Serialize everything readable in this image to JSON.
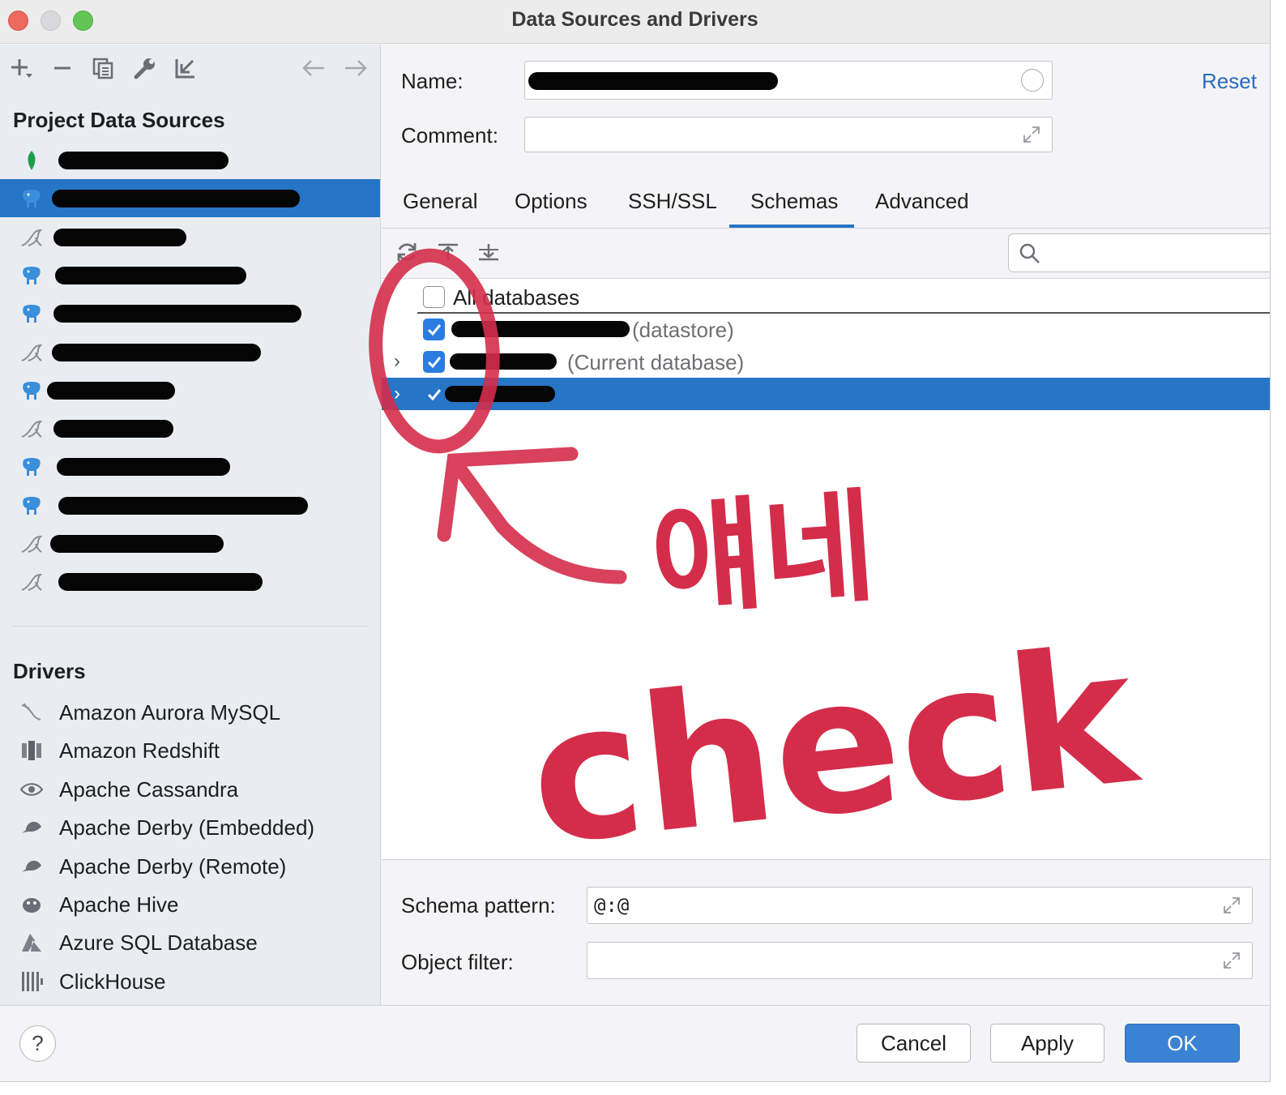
{
  "window": {
    "title": "Data Sources and Drivers"
  },
  "left": {
    "project_title": "Project Data Sources",
    "drivers_title": "Drivers",
    "datasources": [
      {
        "icon": "mongodb-leaf-icon"
      },
      {
        "icon": "postgresql-elephant-icon",
        "selected": true
      },
      {
        "icon": "mysql-dolphin-icon"
      },
      {
        "icon": "postgresql-elephant-icon"
      },
      {
        "icon": "postgresql-elephant-icon"
      },
      {
        "icon": "mysql-dolphin-icon"
      },
      {
        "icon": "postgresql-elephant-icon"
      },
      {
        "icon": "mysql-dolphin-icon"
      },
      {
        "icon": "postgresql-elephant-icon"
      },
      {
        "icon": "postgresql-elephant-icon"
      },
      {
        "icon": "mysql-dolphin-icon"
      },
      {
        "icon": "mysql-dolphin-icon"
      }
    ],
    "drivers": [
      {
        "label": "Amazon Aurora MySQL",
        "icon": "dolphin-icon"
      },
      {
        "label": "Amazon Redshift",
        "icon": "redshift-icon"
      },
      {
        "label": "Apache Cassandra",
        "icon": "eye-icon"
      },
      {
        "label": "Apache Derby (Embedded)",
        "icon": "derby-hat-icon"
      },
      {
        "label": "Apache Derby (Remote)",
        "icon": "derby-hat-icon"
      },
      {
        "label": "Apache Hive",
        "icon": "hive-bee-icon"
      },
      {
        "label": "Azure SQL Database",
        "icon": "azure-icon"
      },
      {
        "label": "ClickHouse",
        "icon": "clickhouse-bars-icon"
      }
    ]
  },
  "form": {
    "name_label": "Name:",
    "comment_label": "Comment:",
    "reset_label": "Reset"
  },
  "tabs": [
    {
      "label": "General"
    },
    {
      "label": "Options"
    },
    {
      "label": "SSH/SSL"
    },
    {
      "label": "Schemas",
      "active": true
    },
    {
      "label": "Advanced"
    }
  ],
  "schemas": {
    "all_databases_label": "All databases",
    "rows": [
      {
        "suffix": "(datastore)",
        "checked": true
      },
      {
        "suffix": "(Current database)",
        "checked": true,
        "expandable": true
      },
      {
        "suffix": "",
        "checked": true,
        "expandable": true,
        "selected": true
      }
    ],
    "schema_pattern_label": "Schema pattern:",
    "schema_pattern_value": "@:@",
    "object_filter_label": "Object filter:",
    "object_filter_value": ""
  },
  "footer": {
    "help_label": "?",
    "cancel_label": "Cancel",
    "apply_label": "Apply",
    "ok_label": "OK"
  },
  "annotation": {
    "line1": "얘네",
    "line2": "check",
    "color": "#d42d4a"
  },
  "colors": {
    "accent": "#2675c6",
    "link": "#2a6bbf"
  }
}
